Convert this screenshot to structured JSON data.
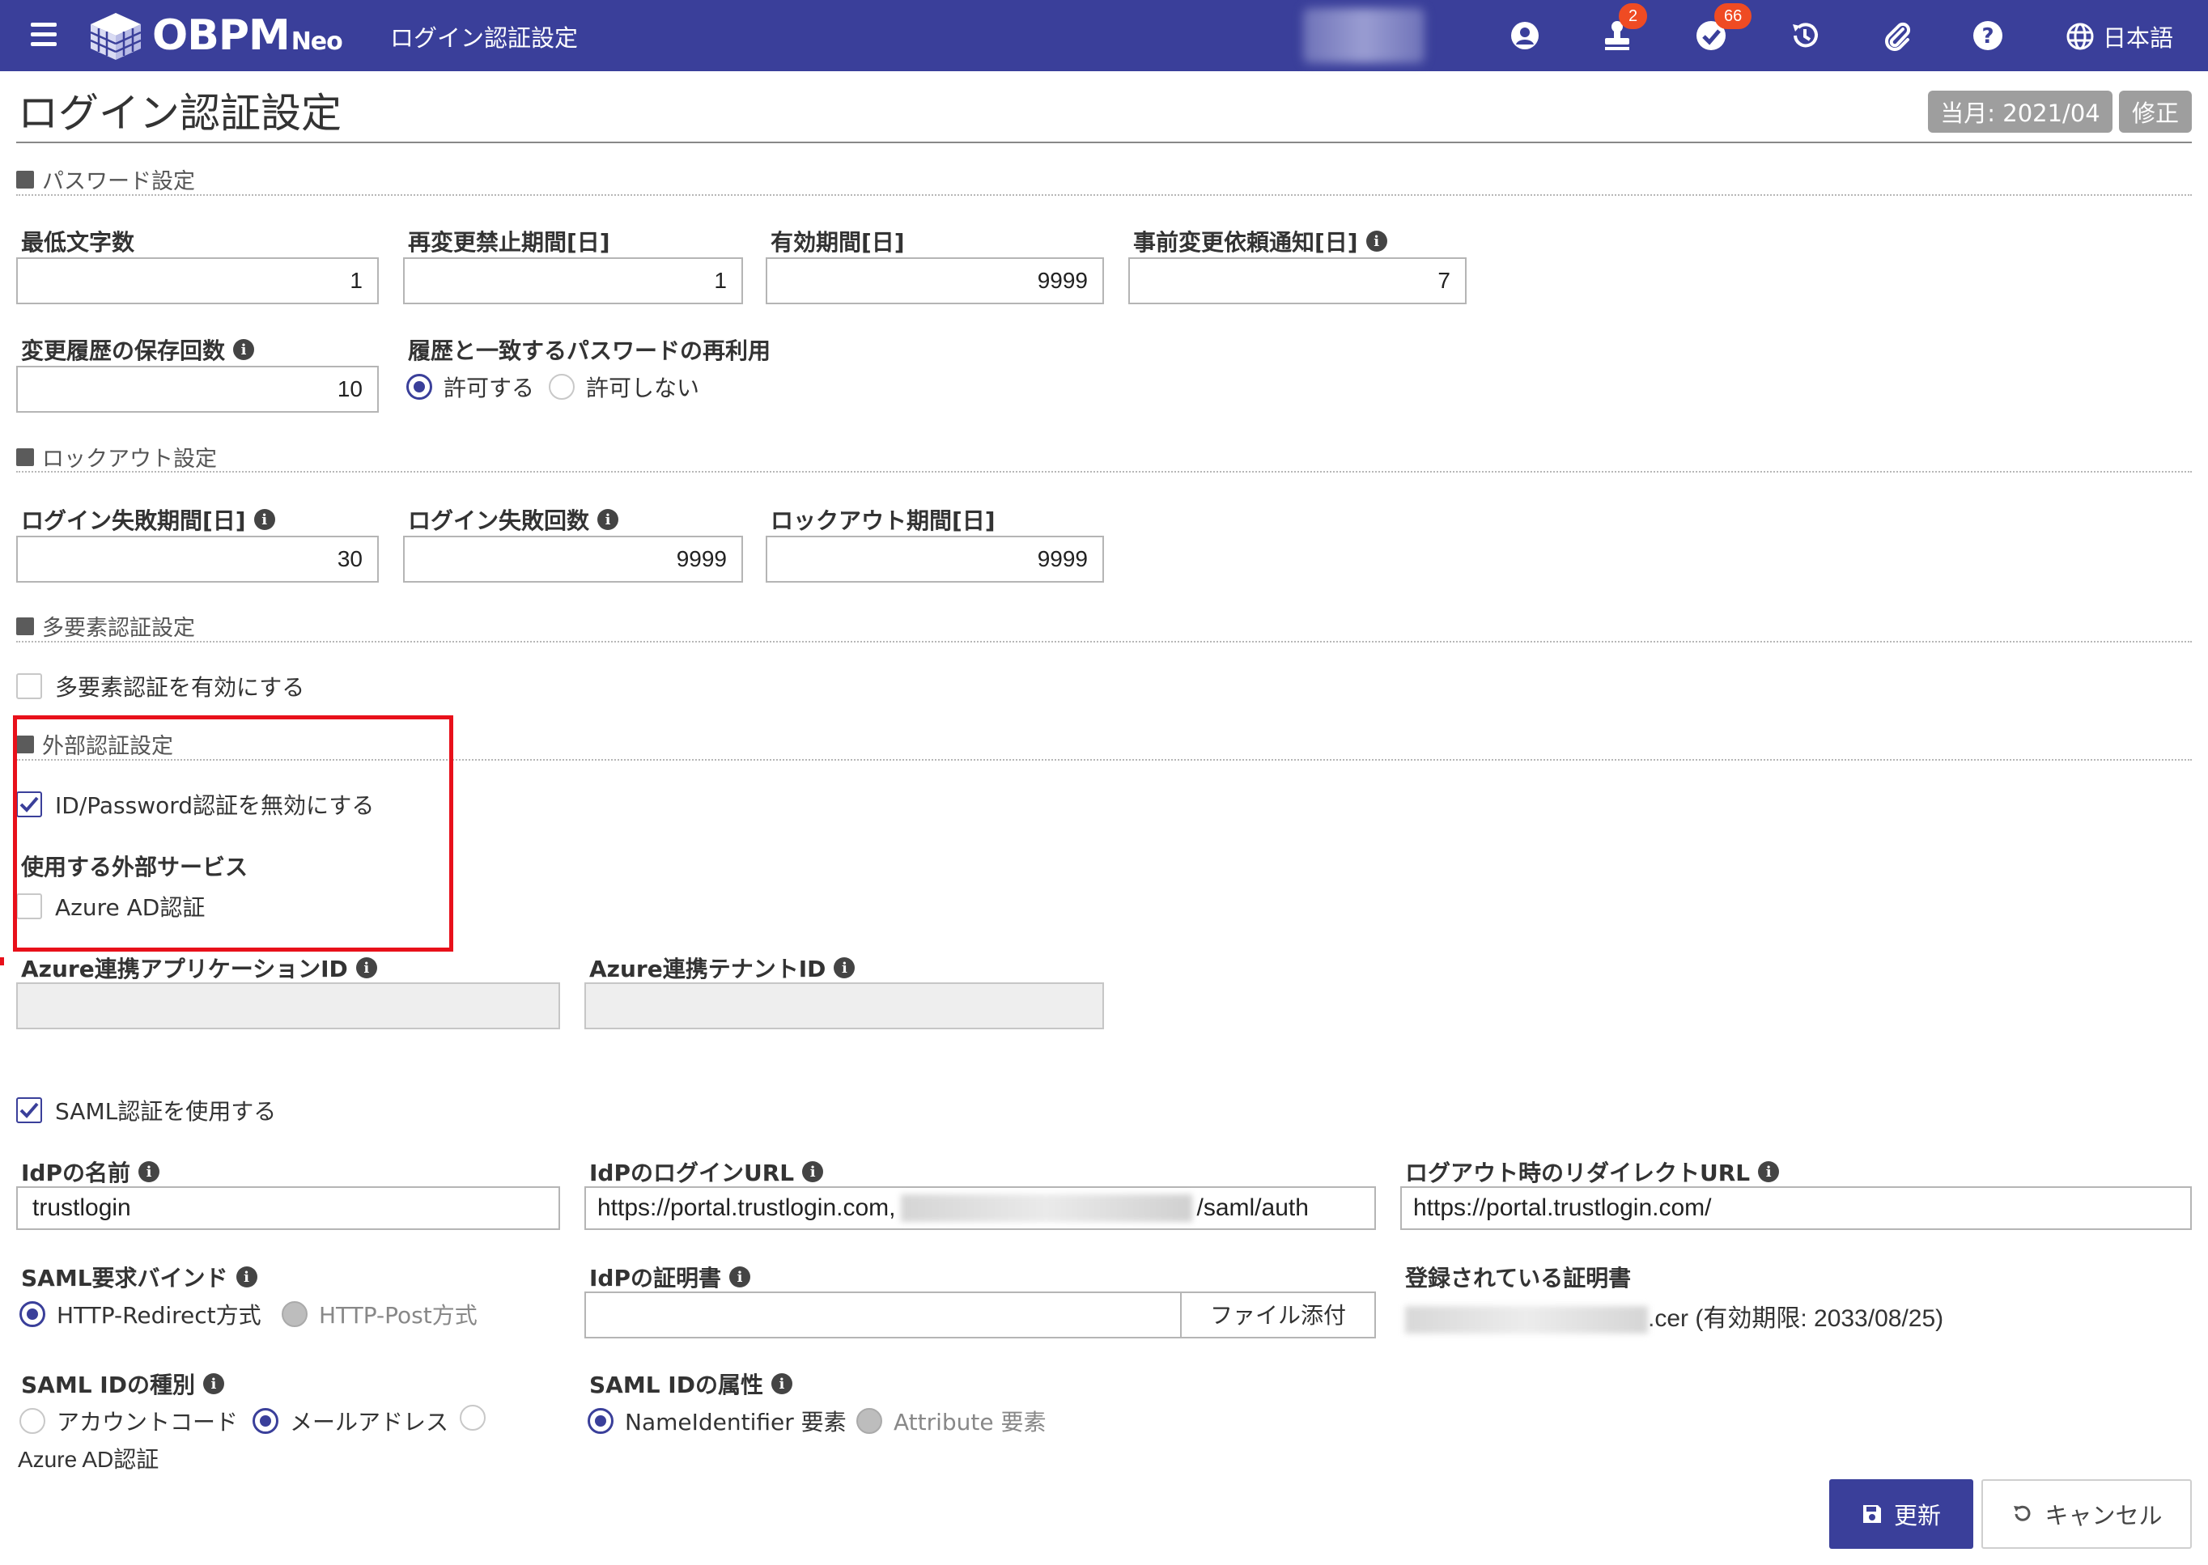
{
  "header": {
    "logo_text": "OBPM",
    "logo_suffix": "Neo",
    "screen_title": "ログイン認証設定",
    "approvals_badge": "2",
    "tasks_badge": "66",
    "language": "日本語",
    "bg_color": "#3a3f9a",
    "badge_color": "#ef4b23"
  },
  "page": {
    "title": "ログイン認証設定",
    "current_month": "当月: 2021/04",
    "edit_label": "修正"
  },
  "password": {
    "section": "パスワード設定",
    "min_length_label": "最低文字数",
    "min_length": "1",
    "no_change_label": "再変更禁止期間[日]",
    "no_change": "1",
    "valid_label": "有効期間[日]",
    "valid": "9999",
    "notify_label": "事前変更依頼通知[日]",
    "notify": "7",
    "history_label": "変更履歴の保存回数",
    "history": "10",
    "reuse_label": "履歴と一致するパスワードの再利用",
    "reuse_allow": "許可する",
    "reuse_deny": "許可しない"
  },
  "lockout": {
    "section": "ロックアウト設定",
    "fail_period_label": "ログイン失敗期間[日]",
    "fail_period": "30",
    "fail_count_label": "ログイン失敗回数",
    "fail_count": "9999",
    "lock_period_label": "ロックアウト期間[日]",
    "lock_period": "9999"
  },
  "mfa": {
    "section": "多要素認証設定",
    "enable_label": "多要素認証を有効にする"
  },
  "external": {
    "section": "外部認証設定",
    "disable_idpw": "ID/Password認証を無効にする",
    "services_label": "使用する外部サービス",
    "azure_label": "Azure AD認証",
    "azure_app_label": "Azure連携アプリケーションID",
    "azure_tenant_label": "Azure連携テナントID"
  },
  "saml": {
    "use_label": "SAML認証を使用する",
    "idp_name_label": "IdPの名前",
    "idp_name": "trustlogin",
    "idp_login_url_label": "IdPのログインURL",
    "idp_login_url_prefix": "https://portal.trustlogin.com,",
    "idp_login_url_suffix": "/saml/auth",
    "logout_url_label": "ログアウト時のリダイレクトURL",
    "logout_url": "https://portal.trustlogin.com/",
    "bind_label": "SAML要求バインド",
    "bind_redirect": "HTTP-Redirect方式",
    "bind_post": "HTTP-Post方式",
    "cert_label": "IdPの証明書",
    "file_attach": "ファイル添付",
    "registered_cert_label": "登録されている証明書",
    "registered_cert_suffix": ".cer (有効期限: 2033/08/25)",
    "id_type_label": "SAML IDの種別",
    "id_type_account": "アカウントコード",
    "id_type_email": "メールアドレス",
    "id_type_azure": "Azure AD認証",
    "id_attr_label": "SAML IDの属性",
    "id_attr_nameid": "NameIdentifier 要素",
    "id_attr_attribute": "Attribute 要素"
  },
  "actions": {
    "update": "更新",
    "cancel": "キャンセル"
  }
}
